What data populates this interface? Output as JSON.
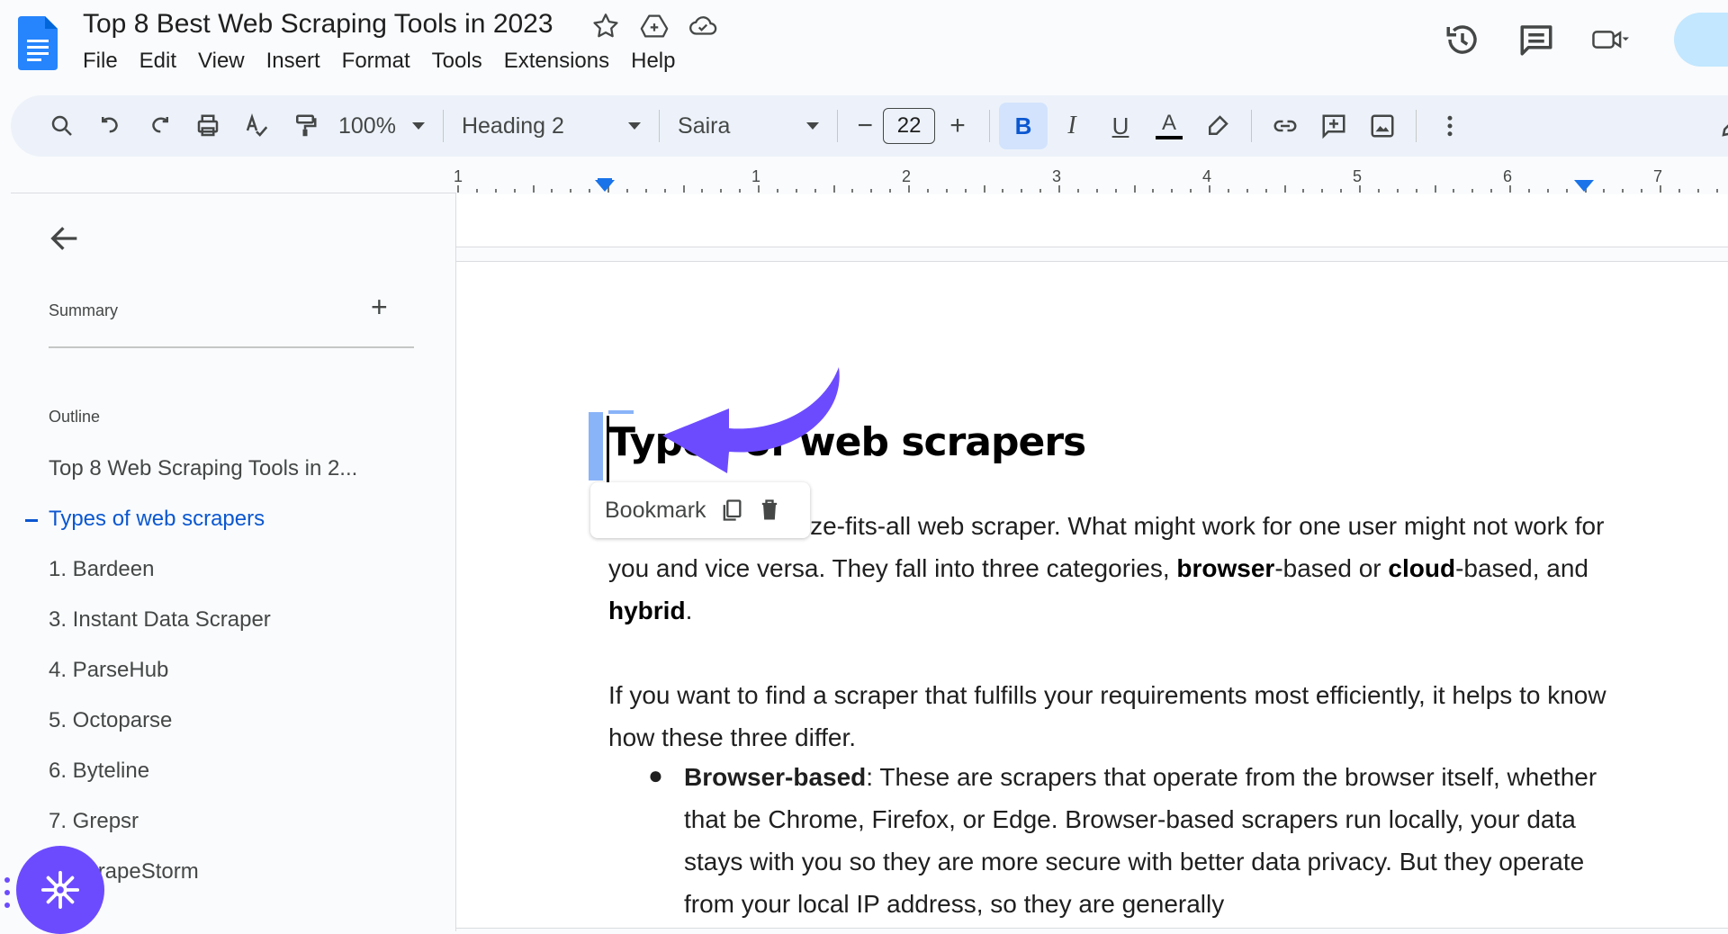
{
  "document": {
    "title": "Top 8 Best Web Scraping Tools in 2023"
  },
  "icons": {
    "star": "star-icon",
    "move": "move-to-drive-icon",
    "cloud": "cloud-saved-icon",
    "history": "history-icon",
    "comments": "comments-icon",
    "meet": "video-camera-icon"
  },
  "menu": [
    "File",
    "Edit",
    "View",
    "Insert",
    "Format",
    "Tools",
    "Extensions",
    "Help"
  ],
  "toolbar": {
    "zoom": "100%",
    "style": "Heading 2",
    "font": "Saira",
    "font_size": "22",
    "minus": "−",
    "plus": "+",
    "bold": "B",
    "italic": "I",
    "underline": "U",
    "text_color": "A"
  },
  "ruler": {
    "numbers": [
      "1",
      "1",
      "2",
      "3",
      "4",
      "5",
      "6",
      "7"
    ]
  },
  "sidebar": {
    "summary_label": "Summary",
    "add": "+",
    "outline_label": "Outline",
    "items": [
      {
        "label": "Top 8 Web Scraping Tools in 2..."
      },
      {
        "label": "Types of web scrapers"
      },
      {
        "label": "1. Bardeen"
      },
      {
        "label": "3. Instant Data Scraper"
      },
      {
        "label": "4. ParseHub"
      },
      {
        "label": "5. Octoparse"
      },
      {
        "label": "6. Byteline"
      },
      {
        "label": "7. Grepsr"
      },
      {
        "label": "8. ScrapeStorm"
      }
    ]
  },
  "content": {
    "heading": "Types of web scrapers",
    "bookmark_label": "Bookmark",
    "p1_a": "There is no one-size-fits-all web scraper. What might work for one user might not work for you and vice versa. They fall into three categories, ",
    "p1_b1": "browser",
    "p1_c": "-based or ",
    "p1_b2": "cloud",
    "p1_d": "-based, and ",
    "p1_b3": "hybrid",
    "p1_e": ".",
    "p2": "If you want to find a scraper that fulfills your requirements most efficiently, it helps to know how these three differ.",
    "bullet_marker": "●",
    "bullet_bold": "Browser-based",
    "bullet_text": ": These are scrapers that operate from the browser itself, whether that be Chrome, Firefox, or Edge. Browser-based scrapers run locally, your data stays with you so they are more secure with better data privacy.  But they operate from your local IP address, so they are generally"
  },
  "colors": {
    "accent": "#0b57d0",
    "toolbar_bg": "#edf2fa",
    "active_bg": "#d3e3fd",
    "bookmark_flag": "#8ab4f8",
    "annotation_arrow": "#6c4bff"
  }
}
